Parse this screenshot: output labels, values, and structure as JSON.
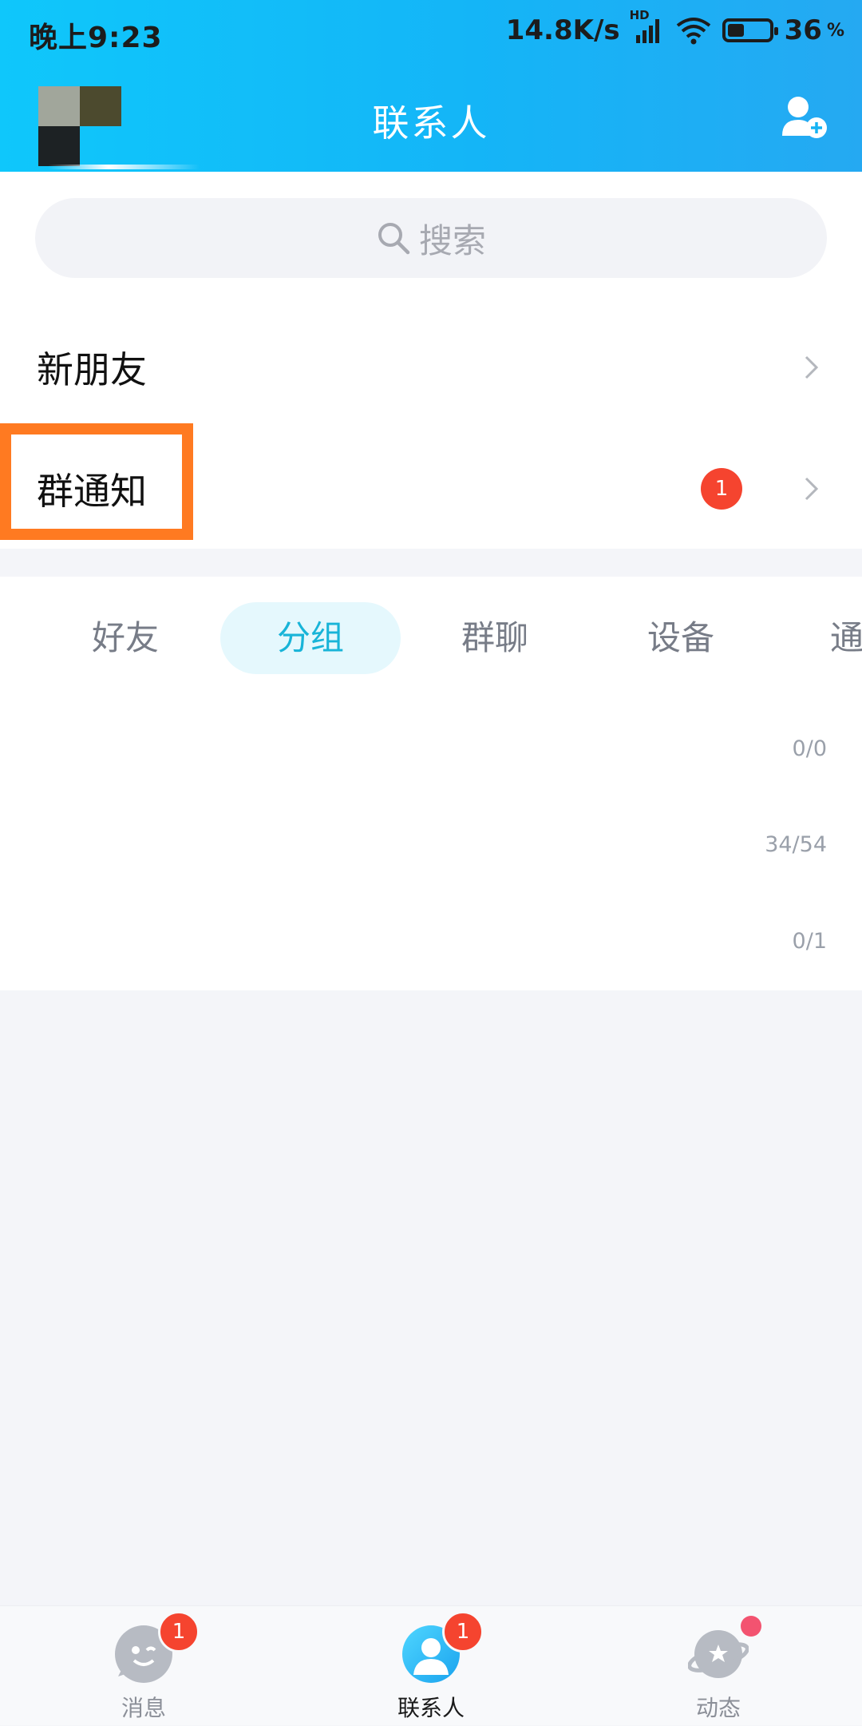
{
  "status_bar": {
    "time": "晚上9:23",
    "network_speed": "14.8K/s",
    "hd": "HD",
    "battery": "36",
    "battery_unit": "%"
  },
  "header": {
    "title": "联系人",
    "avatar_icon": "avatar",
    "add_icon": "add-contact-icon"
  },
  "search": {
    "placeholder": "搜索"
  },
  "rows": [
    {
      "label": "新朋友"
    },
    {
      "label": "群通知",
      "badge": "1"
    }
  ],
  "tabs": [
    {
      "label": "好友",
      "active": false
    },
    {
      "label": "分组",
      "active": true
    },
    {
      "label": "群聊",
      "active": false
    },
    {
      "label": "设备",
      "active": false
    },
    {
      "label": "通",
      "active": false
    }
  ],
  "groups": [
    {
      "count": "0/0"
    },
    {
      "count": "34/54"
    },
    {
      "count": "0/1"
    }
  ],
  "bottom_nav": [
    {
      "label": "消息",
      "badge": "1",
      "active": false
    },
    {
      "label": "联系人",
      "badge": "1",
      "active": true
    },
    {
      "label": "动态",
      "dot": true,
      "active": false
    }
  ],
  "colors": {
    "header_start": "#0fc7fb",
    "header_end": "#25a9f2",
    "accent": "#18b4d8",
    "badge_red": "#f5442f",
    "highlight_orange": "#ff7a21"
  }
}
